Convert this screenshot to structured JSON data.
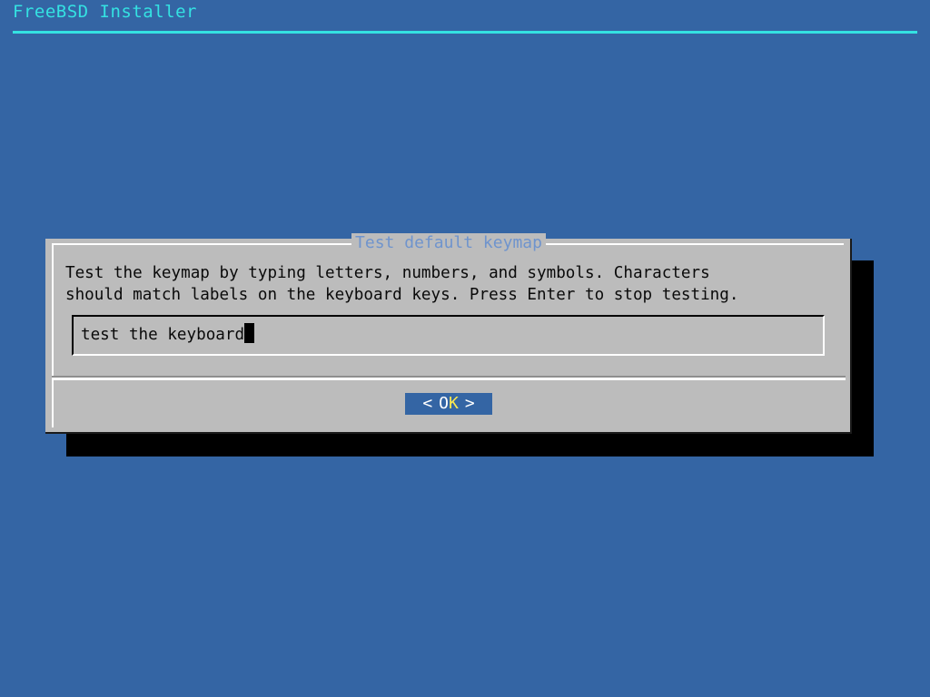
{
  "screen": {
    "background_color": "#3465a4"
  },
  "header": {
    "title": "FreeBSD Installer",
    "title_color": "#34e2e2",
    "rule_color": "#34e2e2"
  },
  "dialog": {
    "title": "Test default keymap",
    "title_color": "#6f94cd",
    "background_color": "#bcbcbc",
    "body_text_line1": "Test the keymap by typing letters, numbers, and symbols. Characters",
    "body_text_line2": "should match labels on the keyboard keys. Press Enter to stop testing.",
    "input": {
      "value": "test the keyboard",
      "placeholder": ""
    },
    "buttons": [
      {
        "left_bracket": "<",
        "label_head": "O",
        "label_key": "K",
        "right_bracket": ">",
        "background_color": "#3465a4",
        "hotkey_color": "#fce94f",
        "selected": true
      }
    ]
  }
}
